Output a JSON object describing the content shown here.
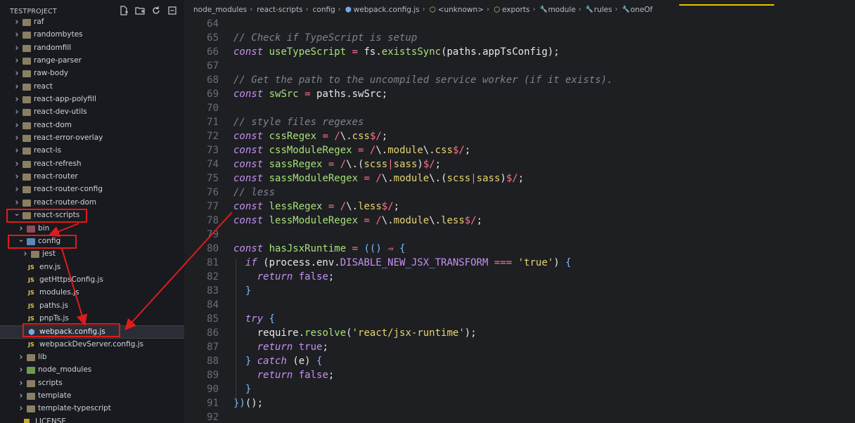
{
  "sidebar": {
    "title": "TESTPROJECT",
    "actions": [
      "new-file-icon",
      "new-folder-icon",
      "refresh-icon",
      "collapse-all-icon"
    ],
    "items": [
      {
        "label": "raf",
        "depth": 0,
        "kind": "folder",
        "state": "collapsed"
      },
      {
        "label": "randombytes",
        "depth": 0,
        "kind": "folder",
        "state": "collapsed"
      },
      {
        "label": "randomfill",
        "depth": 0,
        "kind": "folder",
        "state": "collapsed"
      },
      {
        "label": "range-parser",
        "depth": 0,
        "kind": "folder",
        "state": "collapsed"
      },
      {
        "label": "raw-body",
        "depth": 0,
        "kind": "folder",
        "state": "collapsed"
      },
      {
        "label": "react",
        "depth": 0,
        "kind": "folder",
        "state": "collapsed"
      },
      {
        "label": "react-app-polyfill",
        "depth": 0,
        "kind": "folder",
        "state": "collapsed"
      },
      {
        "label": "react-dev-utils",
        "depth": 0,
        "kind": "folder",
        "state": "collapsed"
      },
      {
        "label": "react-dom",
        "depth": 0,
        "kind": "folder",
        "state": "collapsed"
      },
      {
        "label": "react-error-overlay",
        "depth": 0,
        "kind": "folder",
        "state": "collapsed"
      },
      {
        "label": "react-is",
        "depth": 0,
        "kind": "folder",
        "state": "collapsed"
      },
      {
        "label": "react-refresh",
        "depth": 0,
        "kind": "folder",
        "state": "collapsed"
      },
      {
        "label": "react-router",
        "depth": 0,
        "kind": "folder",
        "state": "collapsed"
      },
      {
        "label": "react-router-config",
        "depth": 0,
        "kind": "folder",
        "state": "collapsed"
      },
      {
        "label": "react-router-dom",
        "depth": 0,
        "kind": "folder",
        "state": "collapsed"
      },
      {
        "label": "react-scripts",
        "depth": 0,
        "kind": "folder",
        "state": "expanded"
      },
      {
        "label": "bin",
        "depth": 1,
        "kind": "folder-bin",
        "state": "collapsed"
      },
      {
        "label": "config",
        "depth": 1,
        "kind": "folder-config",
        "state": "expanded"
      },
      {
        "label": "jest",
        "depth": 2,
        "kind": "folder",
        "state": "collapsed"
      },
      {
        "label": "env.js",
        "depth": 2,
        "kind": "js"
      },
      {
        "label": "getHttpsConfig.js",
        "depth": 2,
        "kind": "js"
      },
      {
        "label": "modules.js",
        "depth": 2,
        "kind": "js"
      },
      {
        "label": "paths.js",
        "depth": 2,
        "kind": "js"
      },
      {
        "label": "pnpTs.js",
        "depth": 2,
        "kind": "js"
      },
      {
        "label": "webpack.config.js",
        "depth": 2,
        "kind": "webpack",
        "selected": true
      },
      {
        "label": "webpackDevServer.config.js",
        "depth": 2,
        "kind": "js"
      },
      {
        "label": "lib",
        "depth": 1,
        "kind": "folder",
        "state": "collapsed"
      },
      {
        "label": "node_modules",
        "depth": 1,
        "kind": "folder-node",
        "state": "collapsed"
      },
      {
        "label": "scripts",
        "depth": 1,
        "kind": "folder",
        "state": "collapsed"
      },
      {
        "label": "template",
        "depth": 1,
        "kind": "folder",
        "state": "collapsed"
      },
      {
        "label": "template-typescript",
        "depth": 1,
        "kind": "folder",
        "state": "collapsed"
      },
      {
        "label": "LICENSE",
        "depth": 1,
        "kind": "file"
      }
    ]
  },
  "breadcrumb": [
    {
      "label": "node_modules",
      "icon": ""
    },
    {
      "label": "react-scripts",
      "icon": ""
    },
    {
      "label": "config",
      "icon": ""
    },
    {
      "label": "webpack.config.js",
      "icon": "webpack-icon"
    },
    {
      "label": "<unknown>",
      "icon": "cube-icon"
    },
    {
      "label": "exports",
      "icon": "cube-icon"
    },
    {
      "label": "module",
      "icon": "wrench-icon"
    },
    {
      "label": "rules",
      "icon": "wrench-icon"
    },
    {
      "label": "oneOf",
      "icon": "wrench-icon"
    }
  ],
  "code": {
    "lines": [
      {
        "n": "64",
        "t": []
      },
      {
        "n": "65",
        "t": [
          [
            "c",
            "// Check if TypeScript is setup"
          ]
        ]
      },
      {
        "n": "66",
        "t": [
          [
            "k",
            "const"
          ],
          [
            "p",
            " "
          ],
          [
            "f",
            "useTypeScript"
          ],
          [
            "p",
            " "
          ],
          [
            "o",
            "="
          ],
          [
            "p",
            " fs."
          ],
          [
            "f",
            "existsSync"
          ],
          [
            "p",
            "(paths.appTsConfig);"
          ]
        ]
      },
      {
        "n": "67",
        "t": []
      },
      {
        "n": "68",
        "t": [
          [
            "c",
            "// Get the path to the uncompiled service worker (if it exists)."
          ]
        ]
      },
      {
        "n": "69",
        "t": [
          [
            "k",
            "const"
          ],
          [
            "p",
            " "
          ],
          [
            "f",
            "swSrc"
          ],
          [
            "p",
            " "
          ],
          [
            "o",
            "="
          ],
          [
            "p",
            " paths.swSrc;"
          ]
        ]
      },
      {
        "n": "70",
        "t": []
      },
      {
        "n": "71",
        "t": [
          [
            "c",
            "// style files regexes"
          ]
        ]
      },
      {
        "n": "72",
        "t": [
          [
            "k",
            "const"
          ],
          [
            "p",
            " "
          ],
          [
            "f",
            "cssRegex"
          ],
          [
            "p",
            " "
          ],
          [
            "o",
            "="
          ],
          [
            "p",
            " "
          ],
          [
            "r",
            "/"
          ],
          [
            "p",
            "\\."
          ],
          [
            "s",
            "css"
          ],
          [
            "r",
            "$/"
          ],
          [
            "p",
            ";"
          ]
        ]
      },
      {
        "n": "73",
        "t": [
          [
            "k",
            "const"
          ],
          [
            "p",
            " "
          ],
          [
            "f",
            "cssModuleRegex"
          ],
          [
            "p",
            " "
          ],
          [
            "o",
            "="
          ],
          [
            "p",
            " "
          ],
          [
            "r",
            "/"
          ],
          [
            "p",
            "\\."
          ],
          [
            "s",
            "module"
          ],
          [
            "p",
            "\\."
          ],
          [
            "s",
            "css"
          ],
          [
            "r",
            "$/"
          ],
          [
            "p",
            ";"
          ]
        ]
      },
      {
        "n": "74",
        "t": [
          [
            "k",
            "const"
          ],
          [
            "p",
            " "
          ],
          [
            "f",
            "sassRegex"
          ],
          [
            "p",
            " "
          ],
          [
            "o",
            "="
          ],
          [
            "p",
            " "
          ],
          [
            "r",
            "/"
          ],
          [
            "p",
            "\\.("
          ],
          [
            "s",
            "scss"
          ],
          [
            "r",
            "|"
          ],
          [
            "s",
            "sass"
          ],
          [
            "p",
            ")"
          ],
          [
            "r",
            "$/"
          ],
          [
            "p",
            ";"
          ]
        ]
      },
      {
        "n": "75",
        "t": [
          [
            "k",
            "const"
          ],
          [
            "p",
            " "
          ],
          [
            "f",
            "sassModuleRegex"
          ],
          [
            "p",
            " "
          ],
          [
            "o",
            "="
          ],
          [
            "p",
            " "
          ],
          [
            "r",
            "/"
          ],
          [
            "p",
            "\\."
          ],
          [
            "s",
            "module"
          ],
          [
            "p",
            "\\.("
          ],
          [
            "s",
            "scss"
          ],
          [
            "r",
            "|"
          ],
          [
            "s",
            "sass"
          ],
          [
            "p",
            ")"
          ],
          [
            "r",
            "$/"
          ],
          [
            "p",
            ";"
          ]
        ]
      },
      {
        "n": "76",
        "t": [
          [
            "c",
            "// less"
          ]
        ]
      },
      {
        "n": "77",
        "t": [
          [
            "k",
            "const"
          ],
          [
            "p",
            " "
          ],
          [
            "f",
            "lessRegex"
          ],
          [
            "p",
            " "
          ],
          [
            "o",
            "="
          ],
          [
            "p",
            " "
          ],
          [
            "r",
            "/"
          ],
          [
            "p",
            "\\."
          ],
          [
            "s",
            "less"
          ],
          [
            "r",
            "$/"
          ],
          [
            "p",
            ";"
          ]
        ]
      },
      {
        "n": "78",
        "t": [
          [
            "k",
            "const"
          ],
          [
            "p",
            " "
          ],
          [
            "f",
            "lessModuleRegex"
          ],
          [
            "p",
            " "
          ],
          [
            "o",
            "="
          ],
          [
            "p",
            " "
          ],
          [
            "r",
            "/"
          ],
          [
            "p",
            "\\."
          ],
          [
            "s",
            "module"
          ],
          [
            "p",
            "\\."
          ],
          [
            "s",
            "less"
          ],
          [
            "r",
            "$/"
          ],
          [
            "p",
            ";"
          ]
        ]
      },
      {
        "n": "79",
        "t": []
      },
      {
        "n": "80",
        "t": [
          [
            "k",
            "const"
          ],
          [
            "p",
            " "
          ],
          [
            "f",
            "hasJsxRuntime"
          ],
          [
            "p",
            " "
          ],
          [
            "o",
            "="
          ],
          [
            "p",
            " "
          ],
          [
            "b",
            "(()"
          ],
          [
            "p",
            " "
          ],
          [
            "o",
            "⇒"
          ],
          [
            "p",
            " "
          ],
          [
            "b",
            "{"
          ]
        ]
      },
      {
        "n": "81",
        "t": [
          [
            "p",
            "  "
          ],
          [
            "k",
            "if"
          ],
          [
            "p",
            " (process.env."
          ],
          [
            "pr",
            "DISABLE_NEW_JSX_TRANSFORM"
          ],
          [
            "p",
            " "
          ],
          [
            "o",
            "==="
          ],
          [
            "p",
            " "
          ],
          [
            "s",
            "'true'"
          ],
          [
            "p",
            ") "
          ],
          [
            "b",
            "{"
          ]
        ]
      },
      {
        "n": "82",
        "t": [
          [
            "p",
            "    "
          ],
          [
            "k",
            "return"
          ],
          [
            "p",
            " "
          ],
          [
            "v",
            "false"
          ],
          [
            "p",
            ";"
          ]
        ]
      },
      {
        "n": "83",
        "t": [
          [
            "p",
            "  "
          ],
          [
            "b",
            "}"
          ]
        ]
      },
      {
        "n": "84",
        "t": []
      },
      {
        "n": "85",
        "t": [
          [
            "p",
            "  "
          ],
          [
            "k",
            "try"
          ],
          [
            "p",
            " "
          ],
          [
            "b",
            "{"
          ]
        ]
      },
      {
        "n": "86",
        "t": [
          [
            "p",
            "    require."
          ],
          [
            "f",
            "resolve"
          ],
          [
            "p",
            "("
          ],
          [
            "s",
            "'react/jsx-runtime'"
          ],
          [
            "p",
            ");"
          ]
        ]
      },
      {
        "n": "87",
        "t": [
          [
            "p",
            "    "
          ],
          [
            "k",
            "return"
          ],
          [
            "p",
            " "
          ],
          [
            "v",
            "true"
          ],
          [
            "p",
            ";"
          ]
        ]
      },
      {
        "n": "88",
        "t": [
          [
            "p",
            "  "
          ],
          [
            "b",
            "}"
          ],
          [
            "p",
            " "
          ],
          [
            "k",
            "catch"
          ],
          [
            "p",
            " (e) "
          ],
          [
            "b",
            "{"
          ]
        ]
      },
      {
        "n": "89",
        "t": [
          [
            "p",
            "    "
          ],
          [
            "k",
            "return"
          ],
          [
            "p",
            " "
          ],
          [
            "v",
            "false"
          ],
          [
            "p",
            ";"
          ]
        ]
      },
      {
        "n": "90",
        "t": [
          [
            "p",
            "  "
          ],
          [
            "b",
            "}"
          ]
        ]
      },
      {
        "n": "91",
        "t": [
          [
            "b",
            "})"
          ],
          [
            "p",
            "();"
          ]
        ]
      },
      {
        "n": "92",
        "t": []
      }
    ]
  },
  "annotations": {
    "color": "#e01b1b"
  }
}
